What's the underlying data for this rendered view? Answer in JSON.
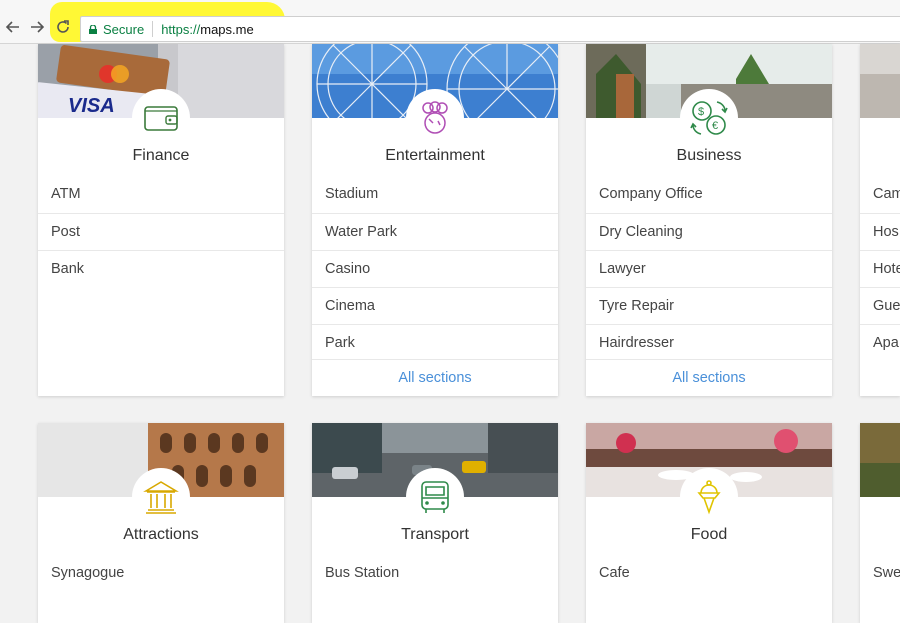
{
  "browser": {
    "secure_label": "Secure",
    "url_prefix": "https://",
    "url_host": "maps.me"
  },
  "cards_row1": [
    {
      "title": "Finance",
      "icon": "wallet-icon",
      "items": [
        "ATM",
        "Post",
        "Bank"
      ]
    },
    {
      "title": "Entertainment",
      "icon": "balloons-icon",
      "items": [
        "Stadium",
        "Water Park",
        "Casino",
        "Cinema",
        "Park"
      ],
      "more": "All sections"
    },
    {
      "title": "Business",
      "icon": "currency-exchange-icon",
      "items": [
        "Company Office",
        "Dry Cleaning",
        "Lawyer",
        "Tyre Repair",
        "Hairdresser"
      ],
      "more": "All sections"
    },
    {
      "items": [
        "Cam",
        "Hos",
        "Hote",
        "Gue",
        "Apa"
      ]
    }
  ],
  "cards_row2": [
    {
      "title": "Attractions",
      "icon": "museum-icon",
      "items": [
        "Synagogue"
      ]
    },
    {
      "title": "Transport",
      "icon": "bus-icon",
      "items": [
        "Bus Station"
      ]
    },
    {
      "title": "Food",
      "icon": "ice-cream-icon",
      "items": [
        "Cafe"
      ]
    },
    {
      "items": [
        "Swe"
      ]
    }
  ],
  "colors": {
    "finance_icon": "#3a7a3a",
    "entertainment_icon": "#b04fb5",
    "business_icon": "#2f8a4a",
    "attractions_icon": "#d8a800",
    "transport_icon": "#2f8a4a",
    "food_icon": "#e0c400",
    "link": "#4a90d9"
  }
}
